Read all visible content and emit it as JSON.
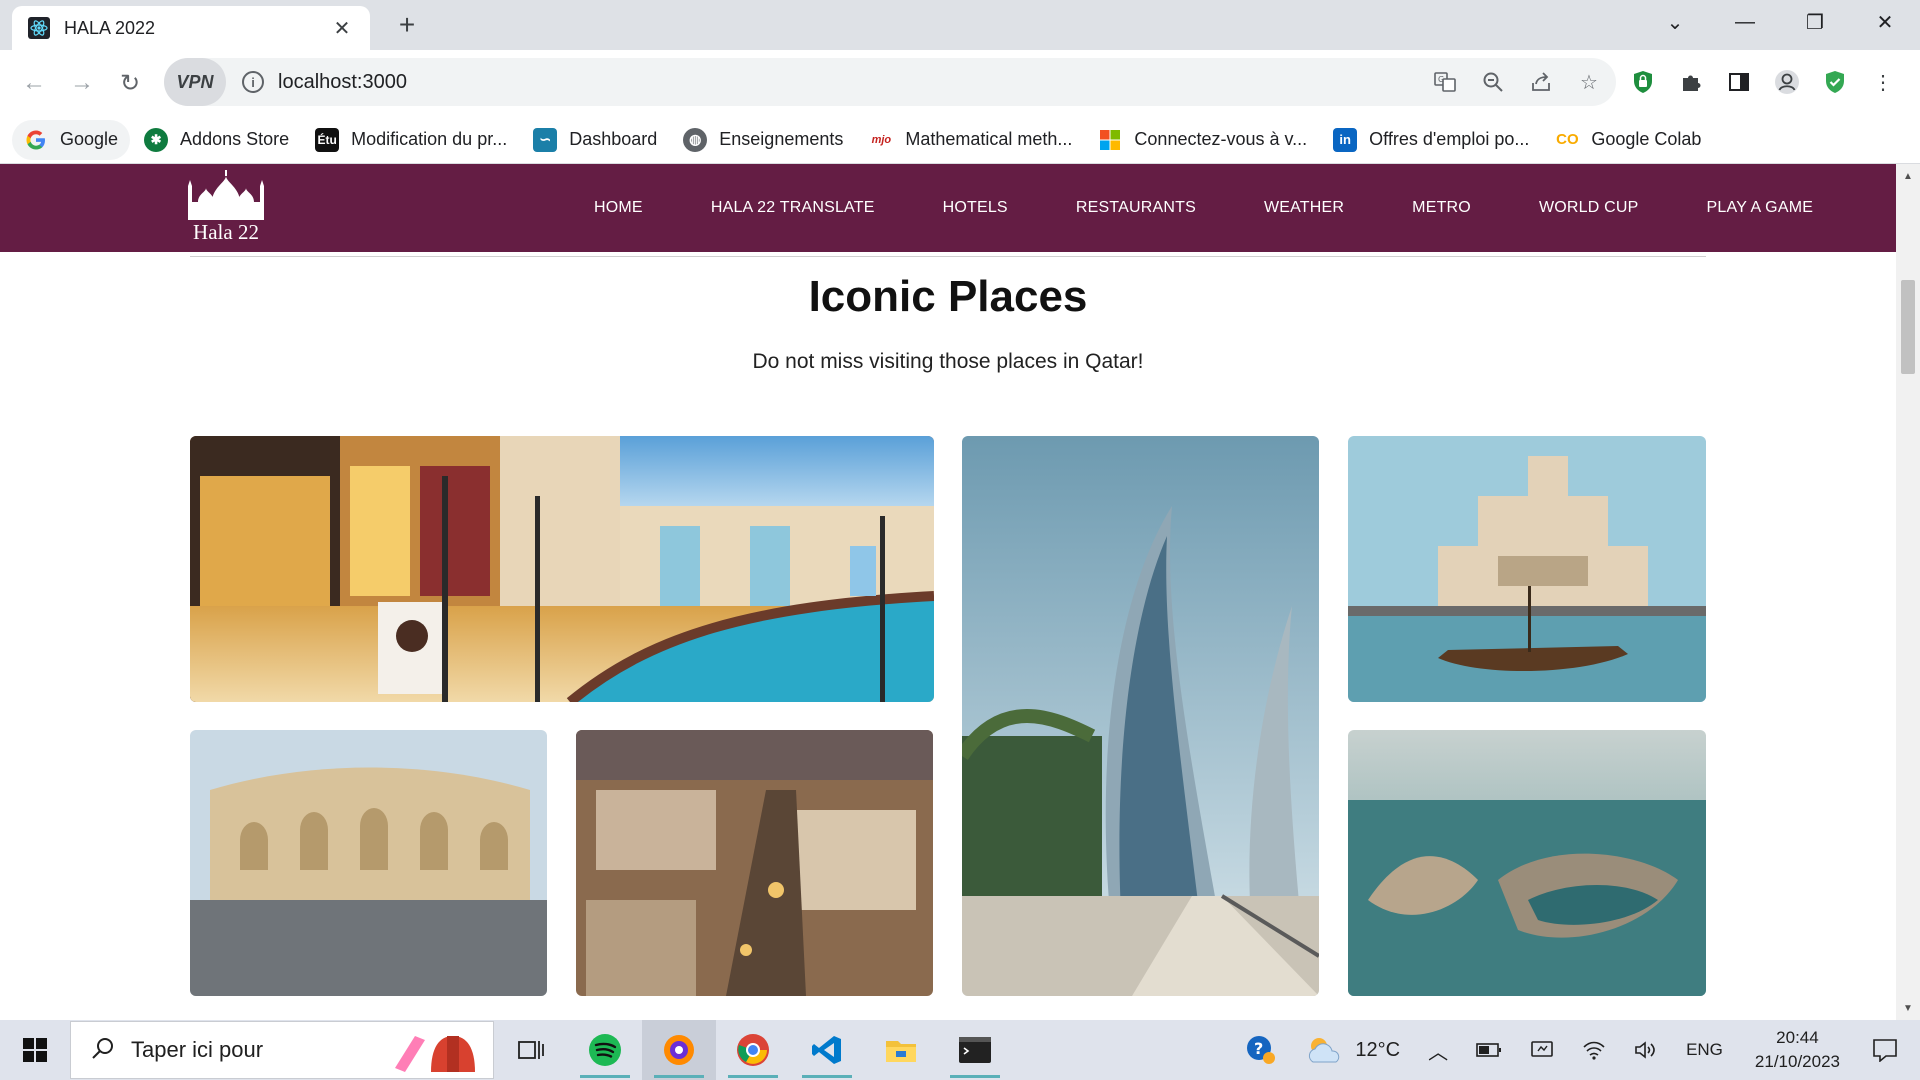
{
  "browser": {
    "tab_title": "HALA 2022",
    "url": "localhost:3000",
    "vpn_label": "VPN"
  },
  "bookmarks": [
    {
      "label": "Google",
      "icon": "google-icon"
    },
    {
      "label": "Addons Store",
      "icon": "addons-store-icon"
    },
    {
      "label": "Modification du pr...",
      "icon": "etu-icon"
    },
    {
      "label": "Dashboard",
      "icon": "dashboard-icon"
    },
    {
      "label": "Enseignements",
      "icon": "globe-icon"
    },
    {
      "label": "Mathematical meth...",
      "icon": "mjo-icon"
    },
    {
      "label": "Connectez-vous à v...",
      "icon": "microsoft-icon"
    },
    {
      "label": "Offres d'emploi po...",
      "icon": "linkedin-icon"
    },
    {
      "label": "Google Colab",
      "icon": "colab-icon"
    }
  ],
  "site": {
    "logo_text": "Hala 22",
    "menu": [
      "HOME",
      "HALA 22 TRANSLATE",
      "HOTELS",
      "RESTAURANTS",
      "WEATHER",
      "METRO",
      "WORLD CUP",
      "PLAY A GAME"
    ],
    "heading": "Iconic Places",
    "subheading": "Do not miss visiting those places in Qatar!",
    "accent_color": "#641d44"
  },
  "taskbar": {
    "search_placeholder": "Taper ici pour",
    "weather": "12°C",
    "language": "ENG",
    "time": "20:44",
    "date": "21/10/2023"
  }
}
